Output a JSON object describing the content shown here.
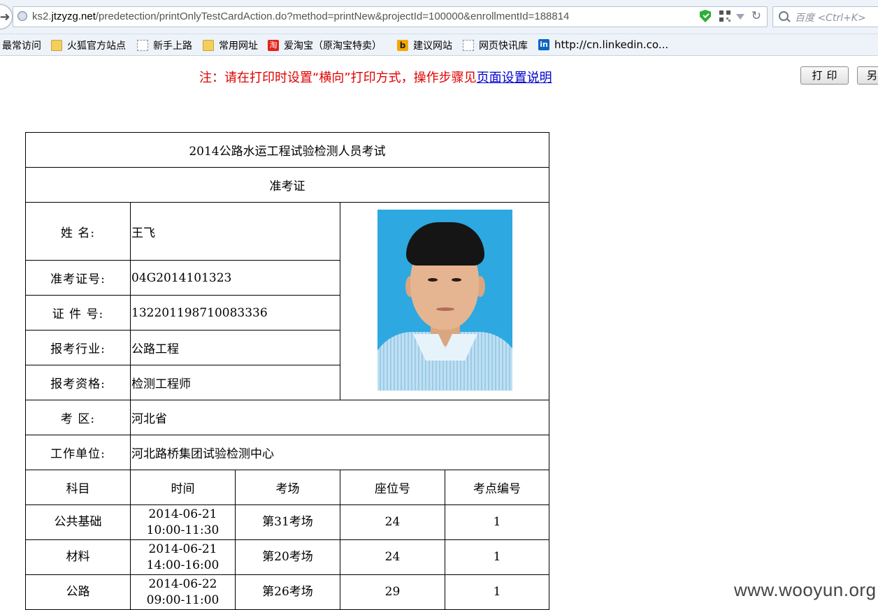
{
  "browser": {
    "url_prefix": "ks2.",
    "url_domain": "jtzyzg.net",
    "url_path": "/predetection/printOnlyTestCardAction.do?method=printNew&projectId=100000&enrollmentId=188814",
    "search_placeholder": "百度 <Ctrl+K>",
    "bookmarks": [
      {
        "label": "最常访问",
        "icon": "none"
      },
      {
        "label": "火狐官方站点",
        "icon": "folder-icon"
      },
      {
        "label": "新手上路",
        "icon": "page-icon"
      },
      {
        "label": "常用网址",
        "icon": "folder-icon"
      },
      {
        "label": "爱淘宝（原淘宝特卖）",
        "icon": "taobao-icon"
      },
      {
        "label": "建议网站",
        "icon": "bing-icon"
      },
      {
        "label": "网页快讯库",
        "icon": "page-icon"
      },
      {
        "label": "http://cn.linkedin.co...",
        "icon": "linkedin-icon"
      }
    ]
  },
  "notice": {
    "text": "注：请在打印时设置“横向”打印方式，操作步骤见",
    "link": "页面设置说明"
  },
  "buttons": {
    "print": "打印",
    "other": "另"
  },
  "card": {
    "exam_title": "2014公路水运工程试验检测人员考试",
    "card_title": "准考证",
    "fields": {
      "name_label": "姓 名:",
      "name_value": "王飞",
      "ticket_label": "准考证号:",
      "ticket_value": "04G2014101323",
      "id_label": "证 件 号:",
      "id_value": "132201198710083336",
      "industry_label": "报考行业:",
      "industry_value": "公路工程",
      "qualification_label": "报考资格:",
      "qualification_value": "检测工程师",
      "region_label": "考 区:",
      "region_value": "河北省",
      "employer_label": "工作单位:",
      "employer_value": "河北路桥集团试验检测中心"
    },
    "schedule_headers": [
      "科目",
      "时间",
      "考场",
      "座位号",
      "考点编号"
    ],
    "schedule": [
      {
        "subject": "公共基础",
        "date": "2014-06-21",
        "time": "10:00-11:30",
        "room": "第31考场",
        "seat": "24",
        "site": "1"
      },
      {
        "subject": "材料",
        "date": "2014-06-21",
        "time": "14:00-16:00",
        "room": "第20考场",
        "seat": "24",
        "site": "1"
      },
      {
        "subject": "公路",
        "date": "2014-06-22",
        "time": "09:00-11:00",
        "room": "第26考场",
        "seat": "29",
        "site": "1"
      }
    ]
  },
  "watermark": "www.wooyun.org"
}
